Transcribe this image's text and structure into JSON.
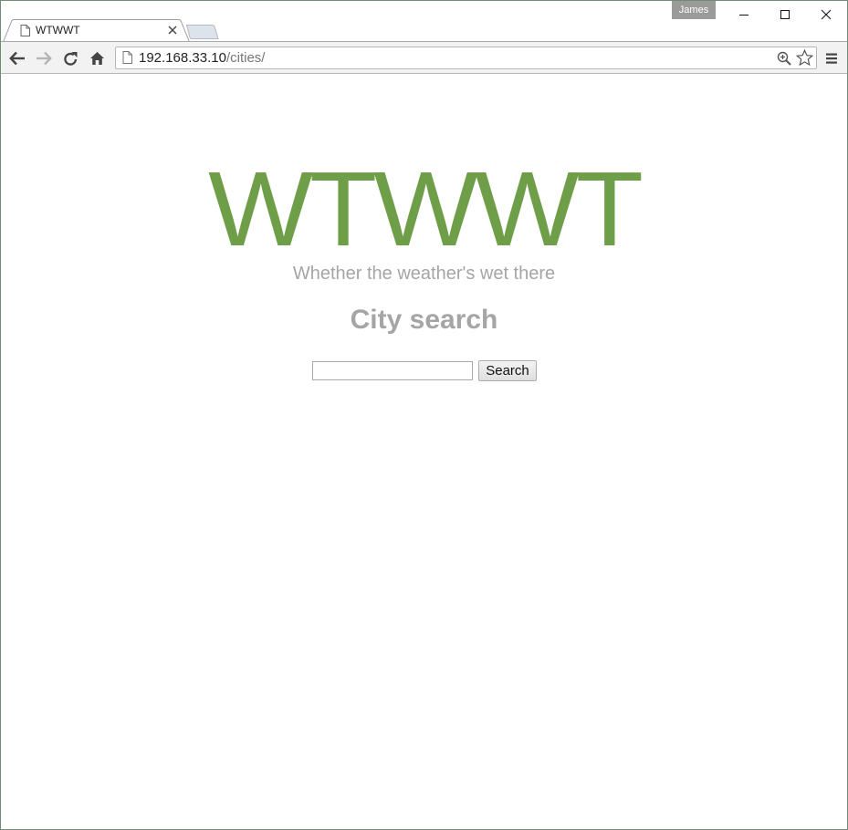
{
  "browser": {
    "profile_name": "James",
    "tab": {
      "title": "WTWWT"
    },
    "address_bar": {
      "host": "192.168.33.10",
      "path": "/cities/"
    }
  },
  "page": {
    "logo_text": "WTWWT",
    "tagline": "Whether the weather's wet there",
    "heading": "City search",
    "search": {
      "value": "",
      "placeholder": "",
      "button_label": "Search"
    }
  },
  "colors": {
    "logo_green": "#6f9e48",
    "muted_gray": "#a5a5a5"
  }
}
